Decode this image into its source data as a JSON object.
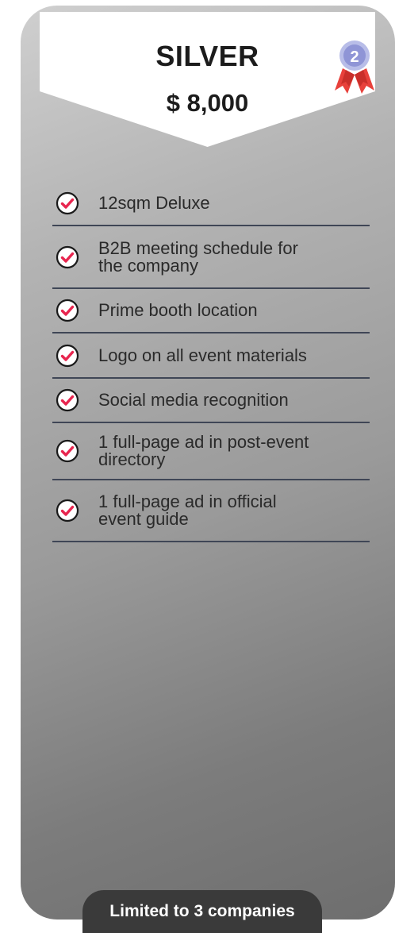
{
  "plan": {
    "tier": "SILVER",
    "price": "$ 8,000",
    "medal_icon": "silver-medal-2-icon",
    "medal_number": "2",
    "colors": {
      "check_accent": "#e8264f",
      "divider": "#3f4656",
      "badge_bg": "#3a3a3a"
    }
  },
  "features": [
    {
      "label": "12sqm Deluxe",
      "icon": "check-circle-icon"
    },
    {
      "label": "B2B meeting schedule for\nthe company",
      "icon": "check-circle-icon"
    },
    {
      "label": "Prime booth location",
      "icon": "check-circle-icon"
    },
    {
      "label": "Logo on all event materials",
      "icon": "check-circle-icon"
    },
    {
      "label": "Social media recognition",
      "icon": "check-circle-icon"
    },
    {
      "label": "1 full-page ad in post-event\ndirectory",
      "icon": "check-circle-icon"
    },
    {
      "label": "1 full-page ad in official\nevent guide",
      "icon": "check-circle-icon"
    }
  ],
  "footer": {
    "badge_text": "Limited to 3 companies"
  }
}
